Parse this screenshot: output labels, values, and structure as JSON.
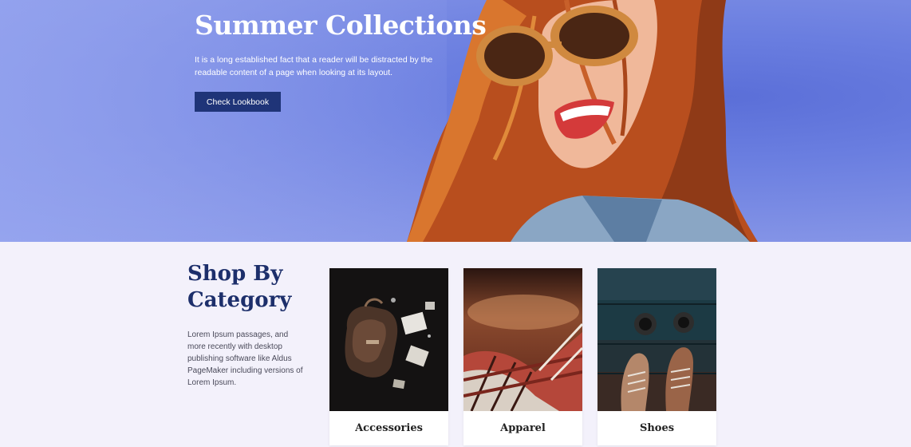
{
  "hero": {
    "title": "Summer Collections",
    "text": "It is a long established fact that a reader will be distracted by the readable content of a page when looking at its layout.",
    "button_label": "Check Lookbook"
  },
  "shop": {
    "title": "Shop By Category",
    "description": "Lorem Ipsum passages, and more recently with desktop publishing software like Aldus PageMaker including versions of Lorem Ipsum.",
    "categories": [
      {
        "label": "Accessories"
      },
      {
        "label": "Apparel"
      },
      {
        "label": "Shoes"
      }
    ]
  },
  "colors": {
    "hero_bg": "#7183e2",
    "button_bg": "#1f3478",
    "heading": "#1d2f6b",
    "page_bg": "#f3f1fb"
  }
}
